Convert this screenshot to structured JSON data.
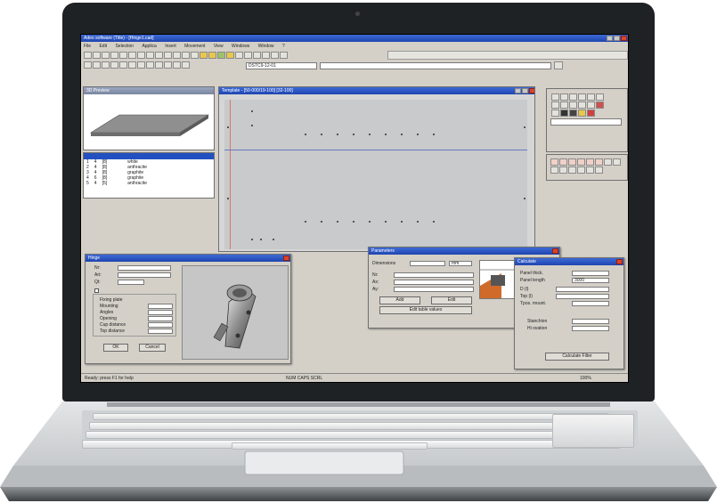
{
  "app": {
    "title": "Adeo software (Title) - [Hinge1.cad]",
    "menu": [
      "File",
      "Edit",
      "Selection",
      "Applica",
      "Insert",
      "Movement",
      "View",
      "Windows",
      "Window",
      "?"
    ],
    "toolbar_text": "DSTC9-12-01",
    "drawing_title": "Template - [50-000/19-100] [32-100]",
    "preview_title": "3D Preview",
    "list_rows": [
      [
        "1",
        "4",
        "[8]",
        "white"
      ],
      [
        "2",
        "4",
        "[8]",
        "anthracite"
      ],
      [
        "3",
        "4",
        "[8]",
        "graphite"
      ],
      [
        "4",
        "6",
        "[8]",
        "graphite"
      ],
      [
        "5",
        "4",
        "[5]",
        "anthracite"
      ]
    ],
    "status_left": "Ready: press F1 for help",
    "status_mid": "NUM    CAPS    SCRL",
    "status_right": "100%",
    "accent": "#2350c0"
  },
  "dialog_hinge": {
    "title": "Hinge",
    "labels": [
      "Nr:",
      "Art:",
      "Qt:"
    ],
    "group_labels": [
      "Fixing plate",
      "Mounting",
      "Angles",
      "Opening",
      "Cup distance",
      "Top distance"
    ],
    "ok": "OK",
    "cancel": "Cancel"
  },
  "dialog_params": {
    "title": "Parameters",
    "top_label": "Dimensions",
    "unit": "mm",
    "rows": [
      "Nr:",
      "Ax:",
      "Ay:"
    ],
    "btn_add": "Add",
    "btn_edit": "Edit",
    "btn_wide": "Edit table values"
  },
  "dialog_calc": {
    "title": "Calculate",
    "labels": [
      "Panel thick.",
      "Panel length",
      "D (l)",
      "Top (l)",
      "Tpos. mount.",
      "Stanchion",
      "Hi ovation"
    ],
    "value": "3000",
    "btn": "Calculate Filter"
  }
}
